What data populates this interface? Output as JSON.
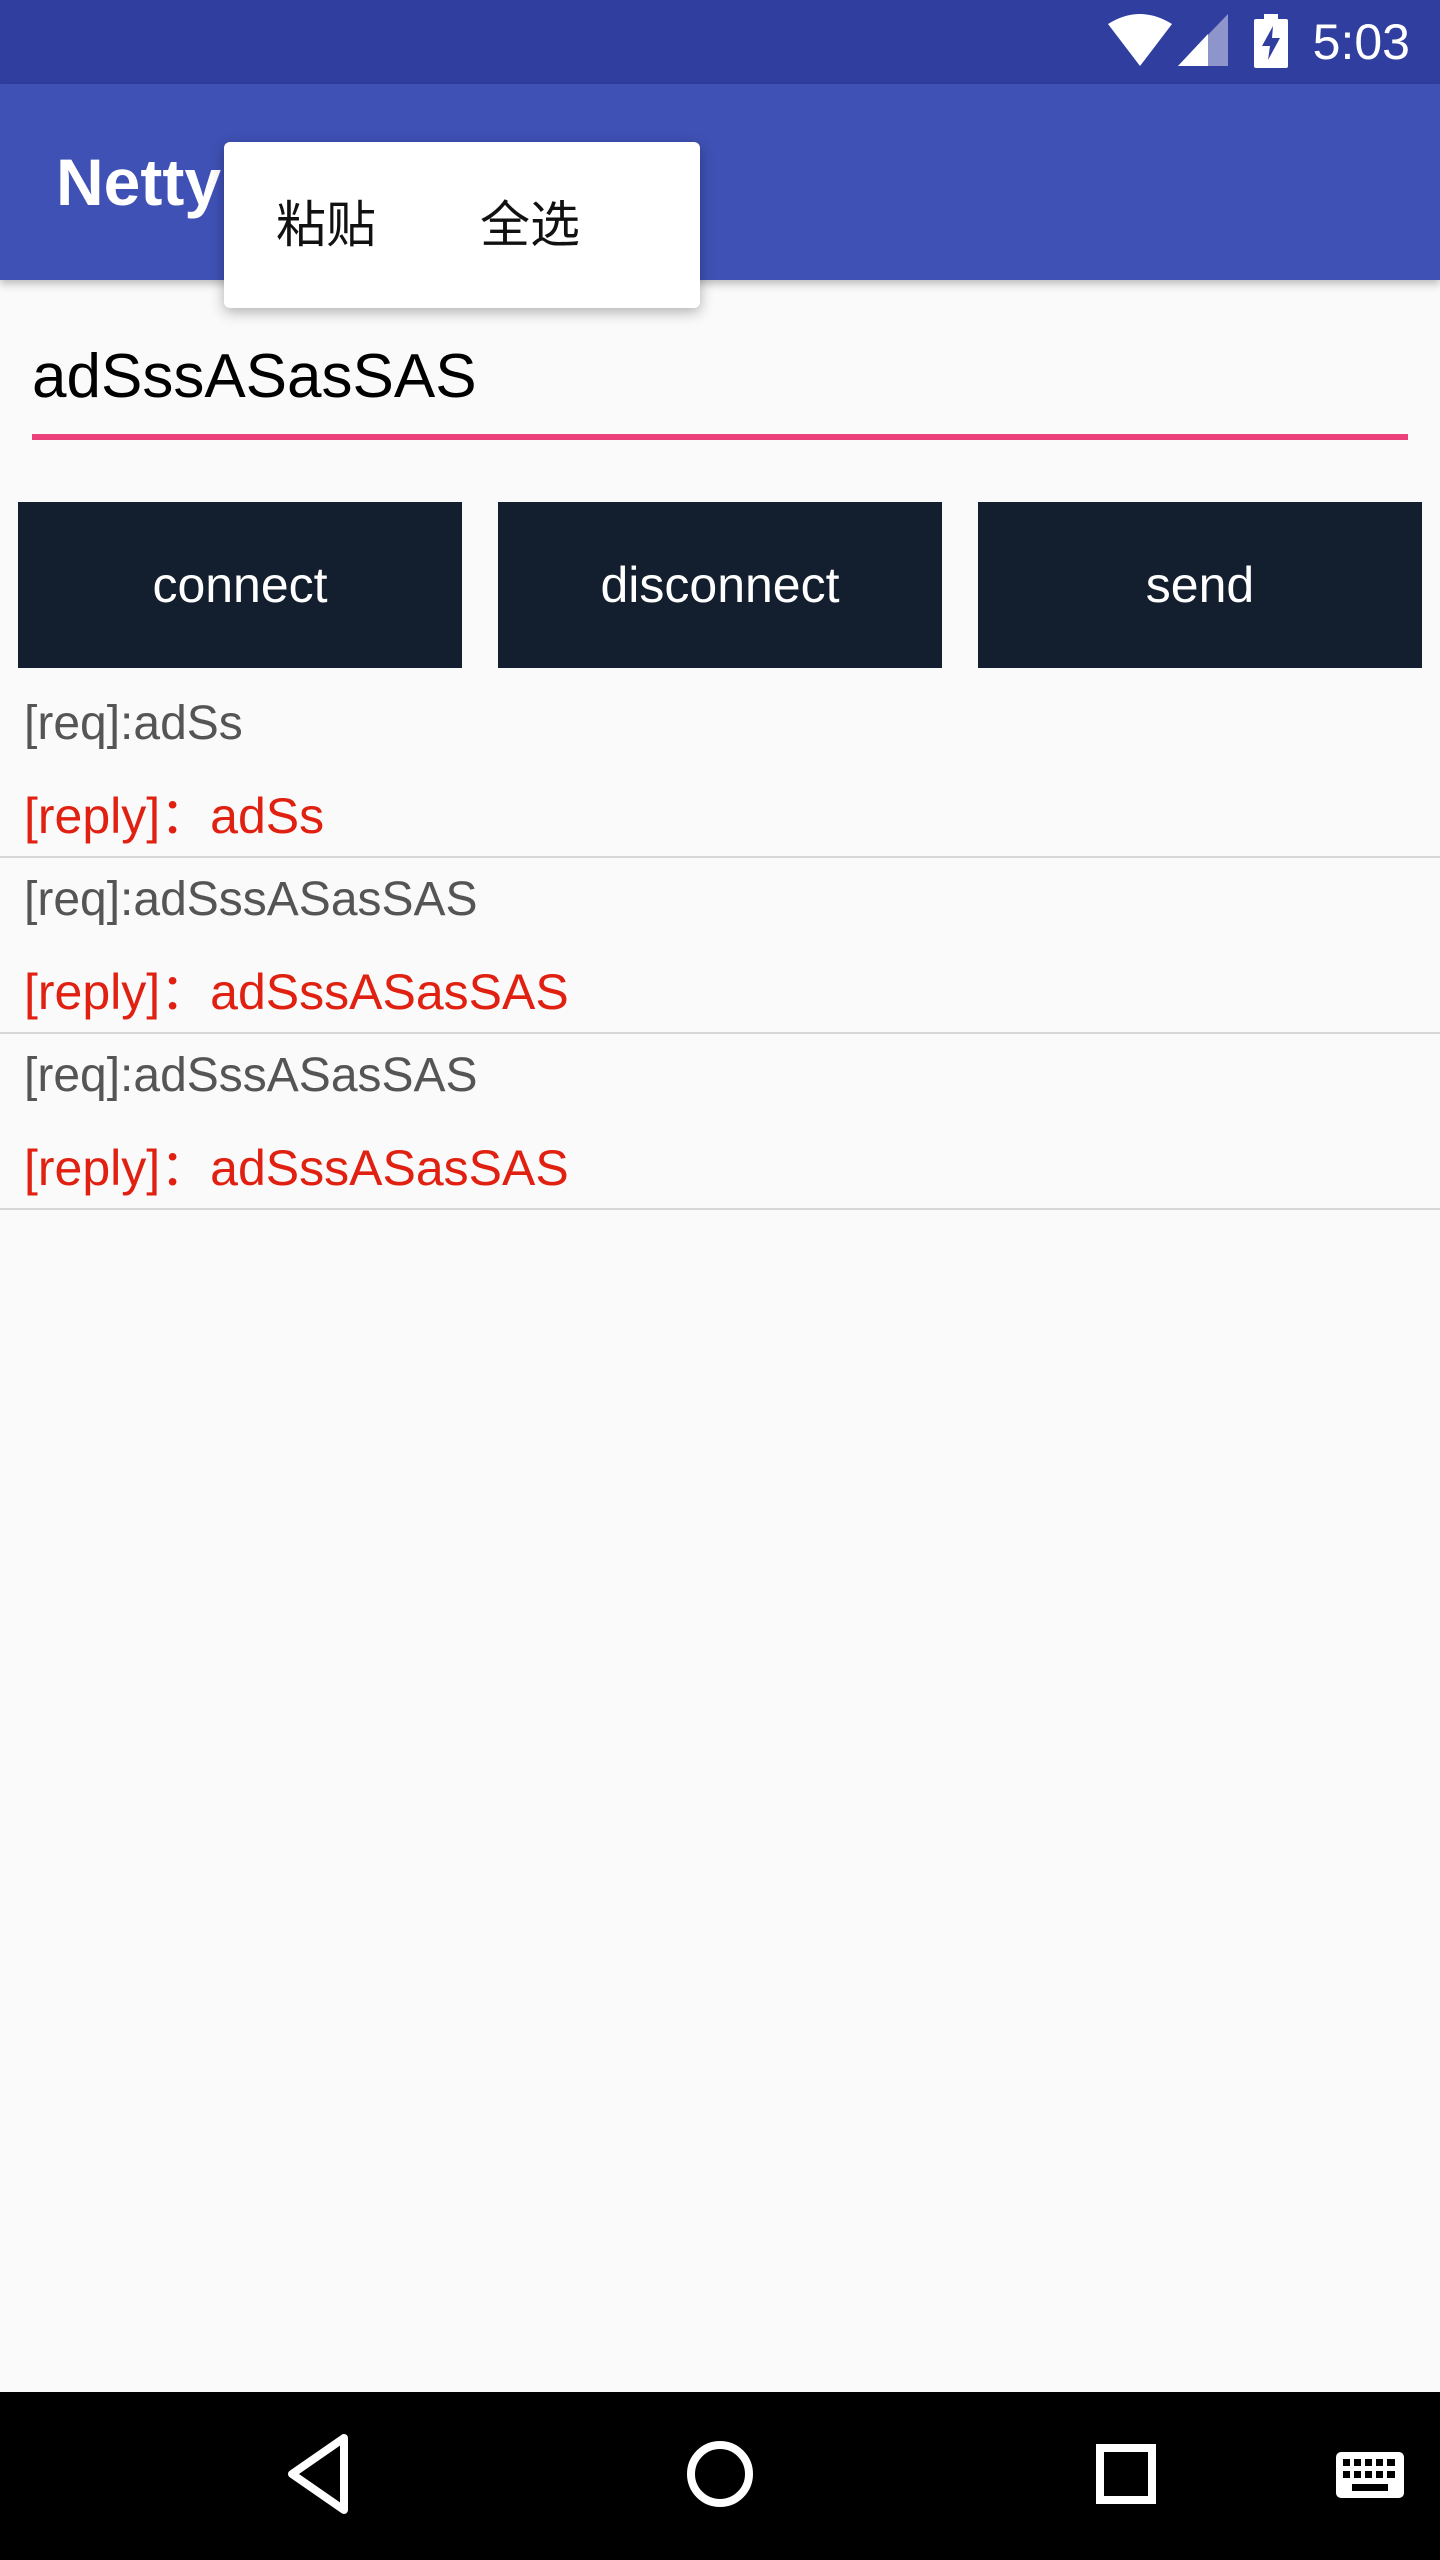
{
  "status_bar": {
    "time": "5:03",
    "icons": [
      "wifi-icon",
      "signal-icon",
      "battery-charging-icon"
    ]
  },
  "app_bar": {
    "title": "Netty"
  },
  "context_menu": {
    "items": [
      {
        "label": "粘贴"
      },
      {
        "label": "全选"
      }
    ]
  },
  "input": {
    "value": "adSssASasSAS",
    "underline_color": "#ec407a"
  },
  "buttons": {
    "connect": "connect",
    "disconnect": "disconnect",
    "send": "send"
  },
  "log": [
    {
      "req": "[req]:adSs",
      "reply": "[reply]：adSs"
    },
    {
      "req": "[req]:adSssASasSAS",
      "reply": "[reply]：adSssASasSAS"
    },
    {
      "req": "[req]:adSssASasSAS",
      "reply": "[reply]：adSssASasSAS"
    }
  ],
  "nav_bar": {
    "icons": [
      "back-icon",
      "home-icon",
      "recents-icon",
      "keyboard-icon"
    ]
  },
  "colors": {
    "status_bar": "#303f9f",
    "app_bar": "#3f51b5",
    "button": "#131f2e",
    "reply_text": "#e02010"
  }
}
